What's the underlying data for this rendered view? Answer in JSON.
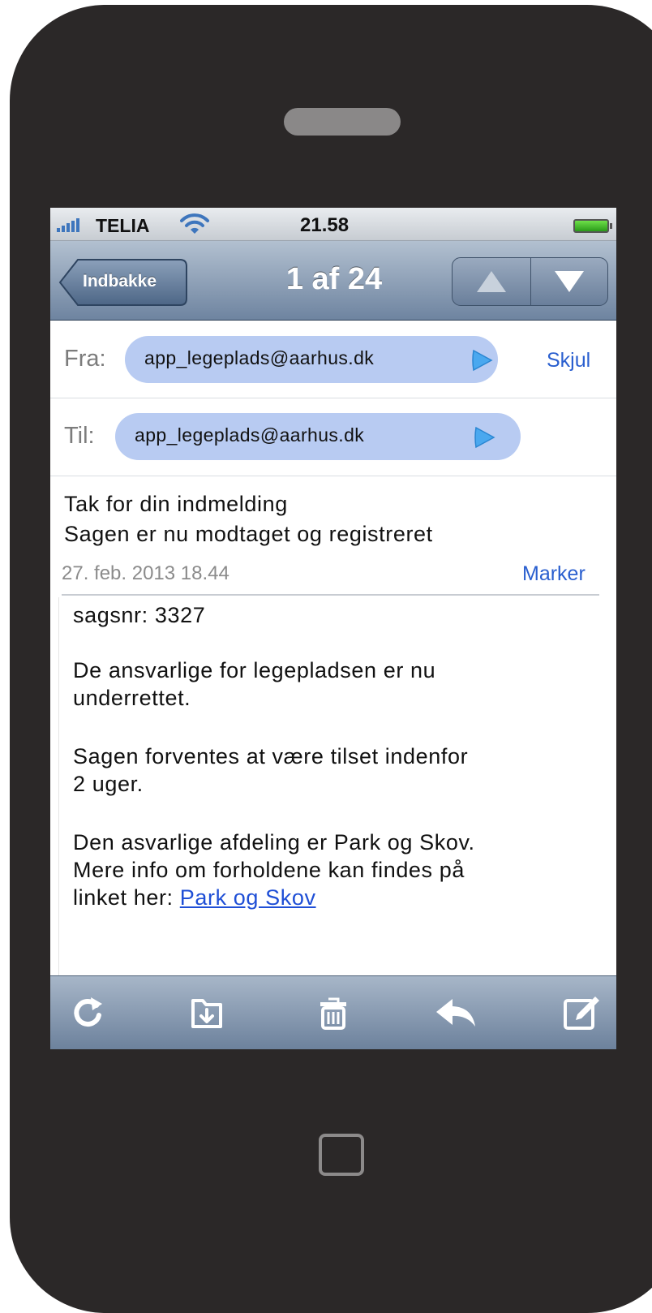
{
  "status_bar": {
    "carrier": "TELIA",
    "time": "21.58",
    "signal_icon": "signal-bars-icon",
    "wifi_icon": "wifi-icon",
    "battery_icon": "battery-icon"
  },
  "nav": {
    "back_label": "Indbakke",
    "title": "1 af 24",
    "prev_icon": "up-arrow-icon",
    "next_icon": "down-arrow-icon"
  },
  "message": {
    "from_label": "Fra:",
    "from_address": "app_legeplads@aarhus.dk",
    "hide_label": "Skjul",
    "to_label": "Til:",
    "to_address": "app_legeplads@aarhus.dk",
    "subject_line1": "Tak for din indmelding",
    "subject_line2": "Sagen er nu modtaget og registreret",
    "date": "27. feb. 2013 18.44",
    "mark_label": "Marker"
  },
  "body": {
    "case_number": "sagsnr: 3327",
    "para1_line1": "De ansvarlige for legepladsen er nu",
    "para1_line2": "underrettet.",
    "para2_line1": "Sagen forventes at være tilset indenfor",
    "para2_line2": "2 uger.",
    "para3_line1": "Den asvarlige afdeling er Park og Skov.",
    "para3_line2": "Mere info om forholdene kan findes på",
    "para3_prefix": "linket her: ",
    "link_text": "Park og Skov"
  },
  "toolbar": {
    "items": [
      "refresh-icon",
      "move-folder-icon",
      "trash-icon",
      "reply-icon",
      "compose-icon"
    ]
  },
  "colors": {
    "nav_bar": "#6e84a0",
    "link_blue": "#2a5fcf",
    "address_bubble": "#b8cbf2",
    "phone_body": "#2b2828"
  }
}
